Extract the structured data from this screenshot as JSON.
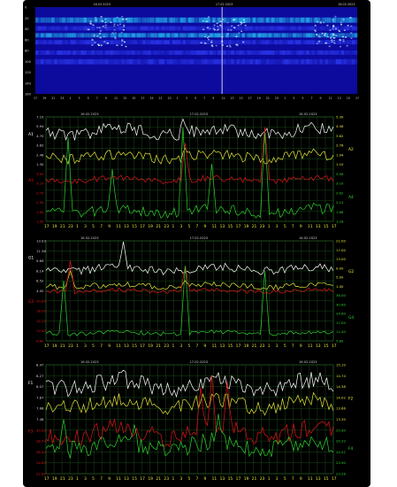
{
  "chart_data": [
    {
      "type": "heatmap",
      "y_tick_labels": [
        "0",
        "20",
        "40",
        "60",
        "80",
        "100",
        "120",
        "140",
        "160"
      ],
      "top_date_labels": [
        "16.02.2023",
        "17.02.2023",
        "18.02.2023"
      ],
      "x_hour_labels": [
        "17",
        "19",
        "21",
        "23",
        "1",
        "3",
        "5",
        "7",
        "9",
        "11",
        "13",
        "15",
        "17",
        "19",
        "21",
        "23",
        "1",
        "3",
        "5",
        "7",
        "9",
        "11",
        "13",
        "15",
        "17",
        "19",
        "21",
        "23",
        "1",
        "3",
        "5",
        "7",
        "9",
        "11",
        "13",
        "15",
        "17"
      ],
      "colors": {
        "background": "#0d0a9e",
        "mid": "#2d3cf2",
        "high": "#26c6f7",
        "peak": "#c8f7ff"
      }
    },
    {
      "type": "line",
      "date_labels": [
        "16.02.2023",
        "17.02.2023",
        "18.02.2023"
      ],
      "left_series_names": [
        "A1",
        "A3"
      ],
      "right_series_names": [
        "A2",
        "A4"
      ],
      "left_ticks": [
        "7.10",
        "5.94",
        "4.70",
        "3.62",
        "2.46",
        "1.30",
        "3.50",
        "3.10",
        "2.70",
        "2.30",
        "1.90",
        "1.50"
      ],
      "right_ticks": [
        "5.30",
        "4.46",
        "3.62",
        "2.78",
        "1.94",
        "1.10",
        "3.58",
        "3.10",
        "2.62",
        "2.14",
        "1.66",
        "1.18"
      ],
      "x_labels": [
        "17",
        "19",
        "21",
        "23",
        "1",
        "3",
        "5",
        "7",
        "9",
        "11",
        "13",
        "15",
        "17",
        "19",
        "21",
        "23",
        "1",
        "3",
        "5",
        "7",
        "9",
        "11",
        "13",
        "15",
        "17",
        "19",
        "21",
        "23",
        "1",
        "3",
        "5",
        "7",
        "9",
        "11",
        "13",
        "15",
        "17"
      ],
      "series": [
        {
          "name": "A1",
          "color": "#ffffff",
          "base": 0.14,
          "amp": 0.06,
          "spikes": [
            [
              18,
              0.85
            ],
            [
              26,
              0.55
            ],
            [
              62,
              0.98
            ],
            [
              98,
              0.7
            ],
            [
              101,
              0.5
            ]
          ]
        },
        {
          "name": "A2",
          "color": "#e6e63a",
          "base": 0.38,
          "amp": 0.05,
          "spikes": [
            [
              20,
              0.3
            ],
            [
              63,
              0.7
            ],
            [
              100,
              0.45
            ]
          ]
        },
        {
          "name": "A3",
          "color": "#e3141a",
          "base": 0.6,
          "amp": 0.03,
          "spikes": [
            [
              63,
              0.75
            ],
            [
              99,
              0.9
            ]
          ]
        },
        {
          "name": "A4",
          "color": "#2fd12f",
          "base": 0.9,
          "amp": 0.05,
          "spikes": [
            [
              10,
              0.8
            ],
            [
              30,
              0.5
            ],
            [
              62,
              0.9
            ],
            [
              75,
              0.55
            ],
            [
              99,
              0.85
            ]
          ]
        }
      ]
    },
    {
      "type": "line",
      "date_labels": [
        "16.02.2023",
        "17.02.2023",
        "18.02.2023"
      ],
      "left_series_names": [
        "G1",
        "G3"
      ],
      "right_series_names": [
        "G2",
        "G4"
      ],
      "left_ticks": [
        "13.03",
        "11.36",
        "9.69",
        "8.14",
        "6.52",
        "4.92",
        "20.80",
        "18.00",
        "15.20",
        "12.40",
        "9.60"
      ],
      "right_ticks": [
        "21.00",
        "17.00",
        "13.00",
        "9.00",
        "5.00",
        "1.00",
        "36.00",
        "30.60",
        "24.60",
        "17.00",
        "11.40",
        "5.80"
      ],
      "x_labels": [
        "17",
        "19",
        "21",
        "23",
        "1",
        "3",
        "5",
        "7",
        "9",
        "11",
        "13",
        "15",
        "17",
        "19",
        "21",
        "23",
        "1",
        "3",
        "5",
        "7",
        "9",
        "11",
        "13",
        "15",
        "17",
        "19",
        "21",
        "23",
        "1",
        "3",
        "5",
        "7",
        "9",
        "11",
        "13",
        "15",
        "17"
      ],
      "series": [
        {
          "name": "G1",
          "color": "#ffffff",
          "base": 0.28,
          "amp": 0.04,
          "spikes": [
            [
              35,
              1.0
            ],
            [
              27,
              0.6
            ],
            [
              52,
              0.5
            ],
            [
              85,
              0.45
            ]
          ]
        },
        {
          "name": "G2",
          "color": "#e6e63a",
          "base": 0.45,
          "amp": 0.03,
          "spikes": [
            [
              11,
              0.7
            ],
            [
              63,
              0.6
            ]
          ]
        },
        {
          "name": "G3",
          "color": "#e3141a",
          "base": 0.5,
          "amp": 0.02,
          "spikes": [
            [
              11,
              0.8
            ],
            [
              63,
              0.75
            ]
          ]
        },
        {
          "name": "G4",
          "color": "#2fd12f",
          "base": 0.92,
          "amp": 0.02,
          "spikes": [
            [
              8,
              0.6
            ],
            [
              63,
              0.75
            ],
            [
              99,
              0.7
            ]
          ]
        }
      ]
    },
    {
      "type": "line",
      "date_labels": [
        "16.02.2023",
        "17.02.2023",
        "18.02.2023"
      ],
      "left_series_names": [
        "F1",
        "F3"
      ],
      "right_series_names": [
        "F2",
        "F4"
      ],
      "left_ticks": [
        "8.47",
        "8.27",
        "8.07",
        "7.87",
        "7.68",
        "7.48",
        "30.00",
        "28.20",
        "26.40",
        "24.60",
        "22.80"
      ],
      "right_ticks": [
        "15.10",
        "14.74",
        "14.38",
        "14.02",
        "13.66",
        "13.30",
        "25.90",
        "25.20",
        "24.52",
        "23.90",
        "23.26"
      ],
      "x_labels": [
        "17",
        "19",
        "21",
        "23",
        "1",
        "3",
        "5",
        "7",
        "9",
        "11",
        "13",
        "15",
        "17",
        "19",
        "21",
        "23",
        "1",
        "3",
        "5",
        "7",
        "9",
        "11",
        "13",
        "15",
        "17",
        "19",
        "21",
        "23",
        "1",
        "3",
        "5",
        "7",
        "9",
        "11",
        "13",
        "15",
        "17"
      ],
      "series": [
        {
          "name": "F1",
          "color": "#ffffff",
          "base": 0.18,
          "amp": 0.08,
          "spikes": [
            [
              35,
              0.95
            ],
            [
              45,
              0.7
            ],
            [
              62,
              0.7
            ]
          ]
        },
        {
          "name": "F2",
          "color": "#e6e63a",
          "base": 0.36,
          "amp": 0.07,
          "spikes": [
            [
              10,
              0.5
            ],
            [
              55,
              0.4
            ]
          ]
        },
        {
          "name": "F3",
          "color": "#e3141a",
          "base": 0.62,
          "amp": 0.09,
          "spikes": [
            [
              70,
              0.8
            ],
            [
              75,
              0.9
            ],
            [
              82,
              0.85
            ]
          ]
        },
        {
          "name": "F4",
          "color": "#2fd12f",
          "base": 0.74,
          "amp": 0.08,
          "spikes": [
            [
              8,
              0.5
            ],
            [
              40,
              0.45
            ],
            [
              78,
              0.55
            ]
          ]
        }
      ]
    }
  ]
}
